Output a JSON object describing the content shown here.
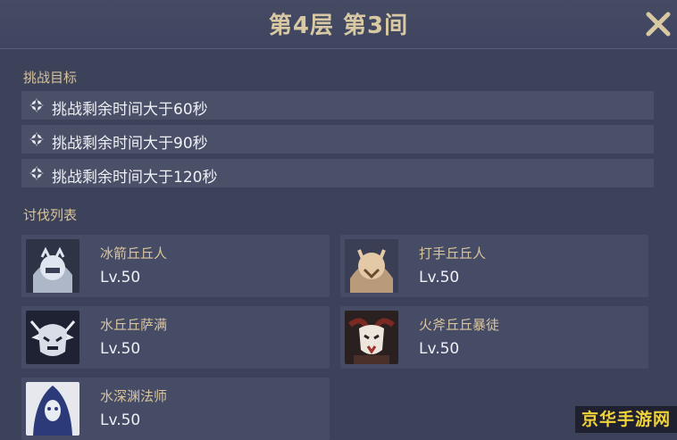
{
  "header": {
    "title": "第4层 第3间"
  },
  "objectives": {
    "label": "挑战目标",
    "items": [
      {
        "text": "挑战剩余时间大于60秒"
      },
      {
        "text": "挑战剩余时间大于90秒"
      },
      {
        "text": "挑战剩余时间大于120秒"
      }
    ]
  },
  "enemies": {
    "label": "讨伐列表",
    "items": [
      {
        "name": "冰箭丘丘人",
        "level": "Lv.50",
        "icon": "ice-archer-hilichurl-portrait"
      },
      {
        "name": "打手丘丘人",
        "level": "Lv.50",
        "icon": "fighter-hilichurl-portrait"
      },
      {
        "name": "水丘丘萨满",
        "level": "Lv.50",
        "icon": "hydro-samachurl-portrait"
      },
      {
        "name": "火斧丘丘暴徒",
        "level": "Lv.50",
        "icon": "pyro-axe-mitachurl-portrait"
      },
      {
        "name": "水深渊法师",
        "level": "Lv.50",
        "icon": "hydro-abyss-mage-portrait"
      }
    ]
  },
  "watermark": {
    "text": "京华手游网"
  },
  "colors": {
    "accent": "#d8c9a3",
    "background": "#3c4259",
    "row": "#4a5068"
  }
}
